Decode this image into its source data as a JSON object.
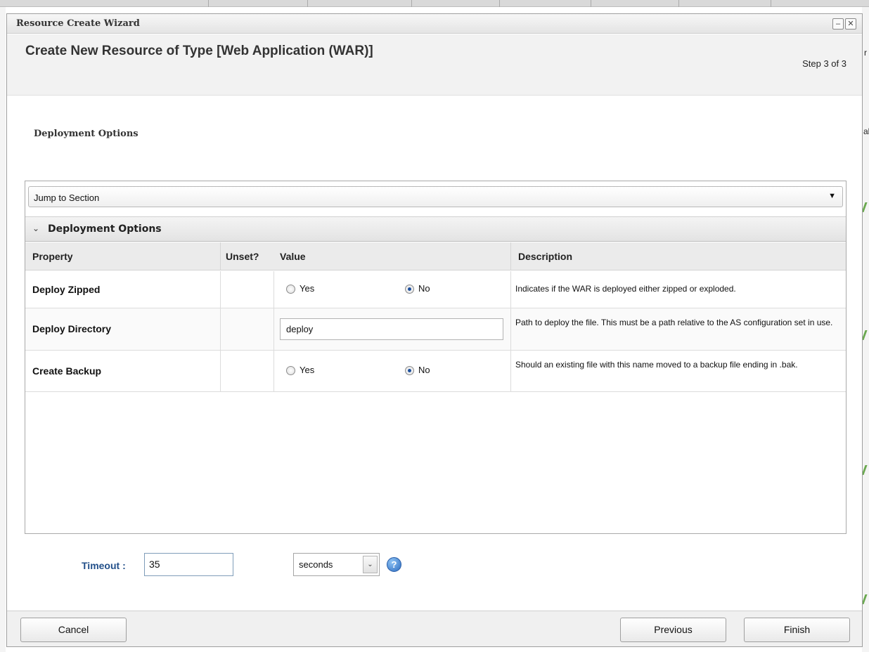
{
  "dialog": {
    "window_title": "Resource Create Wizard",
    "header_title": "Create New Resource of Type [Web Application (WAR)]",
    "step": "Step 3 of 3",
    "section_heading": "Deployment Options",
    "minimize_glyph": "–",
    "close_glyph": "✕"
  },
  "jump_section": {
    "label": "Jump to Section",
    "arrow": "▼"
  },
  "group": {
    "chevron": "⌄",
    "label": "Deployment Options"
  },
  "columns": {
    "property": "Property",
    "unset": "Unset?",
    "value": "Value",
    "description": "Description"
  },
  "rows": [
    {
      "name": "Deploy Zipped",
      "type": "radio",
      "options": [
        "Yes",
        "No"
      ],
      "selected": "No",
      "description": "Indicates if the WAR is deployed either zipped or exploded."
    },
    {
      "name": "Deploy Directory",
      "type": "text",
      "value": "deploy",
      "description": "Path to deploy the file. This must be a path relative to the AS configuration set in use."
    },
    {
      "name": "Create Backup",
      "type": "radio",
      "options": [
        "Yes",
        "No"
      ],
      "selected": "No",
      "description": "Should an existing file with this name moved to a backup file ending in .bak."
    }
  ],
  "timeout": {
    "label": "Timeout :",
    "value": "35",
    "unit": "seconds",
    "unit_arrow": "⌄",
    "help_glyph": "?"
  },
  "footer": {
    "cancel": "Cancel",
    "previous": "Previous",
    "finish": "Finish"
  },
  "background": {
    "glyph_right_1": "r",
    "glyph_right_2": "al"
  }
}
